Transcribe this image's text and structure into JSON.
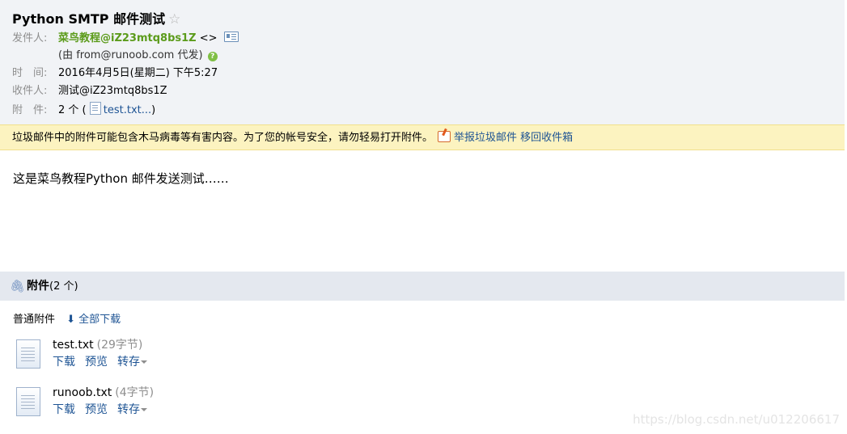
{
  "email": {
    "subject": "Python SMTP 邮件测试",
    "star_glyph": "☆",
    "from_label": "发件人:",
    "from_name": "菜鸟教程@iZ23mtq8bs1Z",
    "from_addr": "<>",
    "sent_via": "(由 from@runoob.com 代发)",
    "time_label": "时　间:",
    "time_value": "2016年4月5日(星期二) 下午5:27",
    "to_label": "收件人:",
    "to_value": "测试@iZ23mtq8bs1Z",
    "att_label": "附　件:",
    "att_count": "2 个 (",
    "att_link": "test.txt...",
    "att_close": ")"
  },
  "warning": {
    "text": "垃圾邮件中的附件可能包含木马病毒等有害内容。为了您的帐号安全，请勿轻易打开附件。",
    "report_link": "举报垃圾邮件",
    "move_link": "移回收件箱"
  },
  "body": {
    "text": "这是菜鸟教程Python 邮件发送测试……"
  },
  "attachments": {
    "title": "附件",
    "count": "(2 个)",
    "section_label": "普通附件",
    "download_all": "⬇ 全部下载",
    "files": [
      {
        "name": "test.txt",
        "size": "(29字节)",
        "download": "下载",
        "preview": "预览",
        "forward": "转存"
      },
      {
        "name": "runoob.txt",
        "size": "(4字节)",
        "download": "下载",
        "preview": "预览",
        "forward": "转存"
      }
    ]
  },
  "watermark": "https://blog.csdn.net/u012206617",
  "colors": {
    "header_bg": "#f1f3f6",
    "sender": "#5b9b1a",
    "link": "#1e5494",
    "warning_bg": "#fcf3c0",
    "attachment_bar": "#e4e8ef"
  }
}
